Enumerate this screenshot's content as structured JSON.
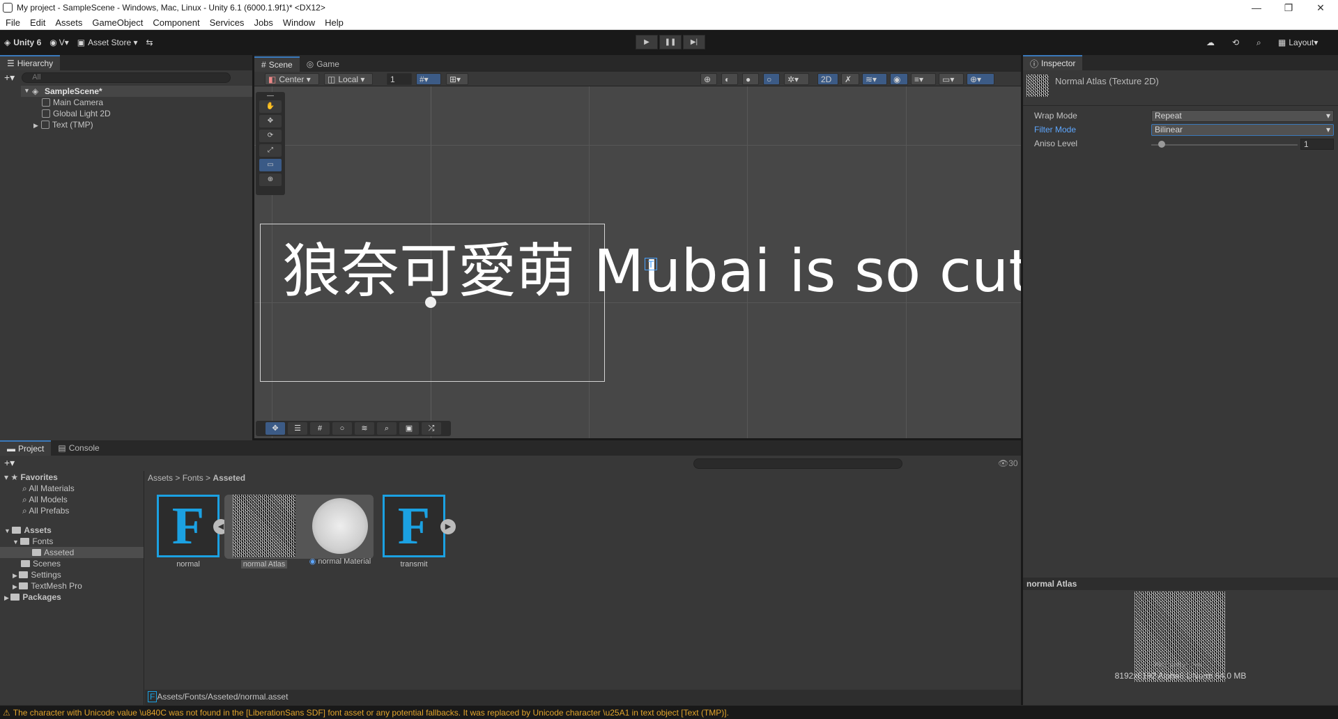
{
  "window": {
    "title": "My project - SampleScene - Windows, Mac, Linux - Unity 6.1 (6000.1.9f1)* <DX12>"
  },
  "menu": [
    "File",
    "Edit",
    "Assets",
    "GameObject",
    "Component",
    "Services",
    "Jobs",
    "Window",
    "Help"
  ],
  "toolbar": {
    "unity": "Unity 6",
    "account": "V",
    "asset_store": "Asset Store",
    "layout": "Layout"
  },
  "hierarchy": {
    "tab": "Hierarchy",
    "search_placeholder": "All",
    "scene": "SampleScene*",
    "items": [
      "Main Camera",
      "Global Light 2D",
      "Text (TMP)"
    ]
  },
  "scene_view": {
    "tabs": [
      "Scene",
      "Game"
    ],
    "pivot": "Center",
    "space": "Local",
    "grid_value": "1",
    "mode_2d": "2D",
    "text": "狼奈可愛萌 Mubai is so cute"
  },
  "inspector": {
    "tab": "Inspector",
    "header": "Normal Atlas (Texture 2D)",
    "rows": [
      {
        "label": "Wrap Mode",
        "value": "Repeat"
      },
      {
        "label": "Filter Mode",
        "value": "Bilinear"
      },
      {
        "label": "Aniso Level",
        "value": "1"
      }
    ],
    "preview_title": "normal Atlas",
    "preview_caption": "Normal Atlas",
    "preview_info": "8192x8192  Alpha8 UNorm  64.0 MB"
  },
  "project": {
    "tabs": [
      "Project",
      "Console"
    ],
    "count": "30",
    "favorites": {
      "label": "Favorites",
      "items": [
        "All Materials",
        "All Models",
        "All Prefabs"
      ]
    },
    "assets_root": "Assets",
    "tree": [
      "Fonts",
      "Asseted",
      "Scenes",
      "Settings",
      "TextMesh Pro"
    ],
    "packages": "Packages",
    "breadcrumb": [
      "Assets",
      "Fonts",
      "Asseted"
    ],
    "assets": [
      "normal",
      "normal Atlas",
      "normal Material",
      "transmit"
    ],
    "path": "Assets/Fonts/Asseted/normal.asset"
  },
  "status": {
    "message": "The character with Unicode value \\u840C was not found in the [LiberationSans SDF] font asset or any potential fallbacks. It was replaced by Unicode character \\u25A1 in text object [Text (TMP)]."
  },
  "colors": {
    "accent": "#3a79bb",
    "font_icon": "#1ba1e2",
    "warning": "#e2a42b"
  }
}
